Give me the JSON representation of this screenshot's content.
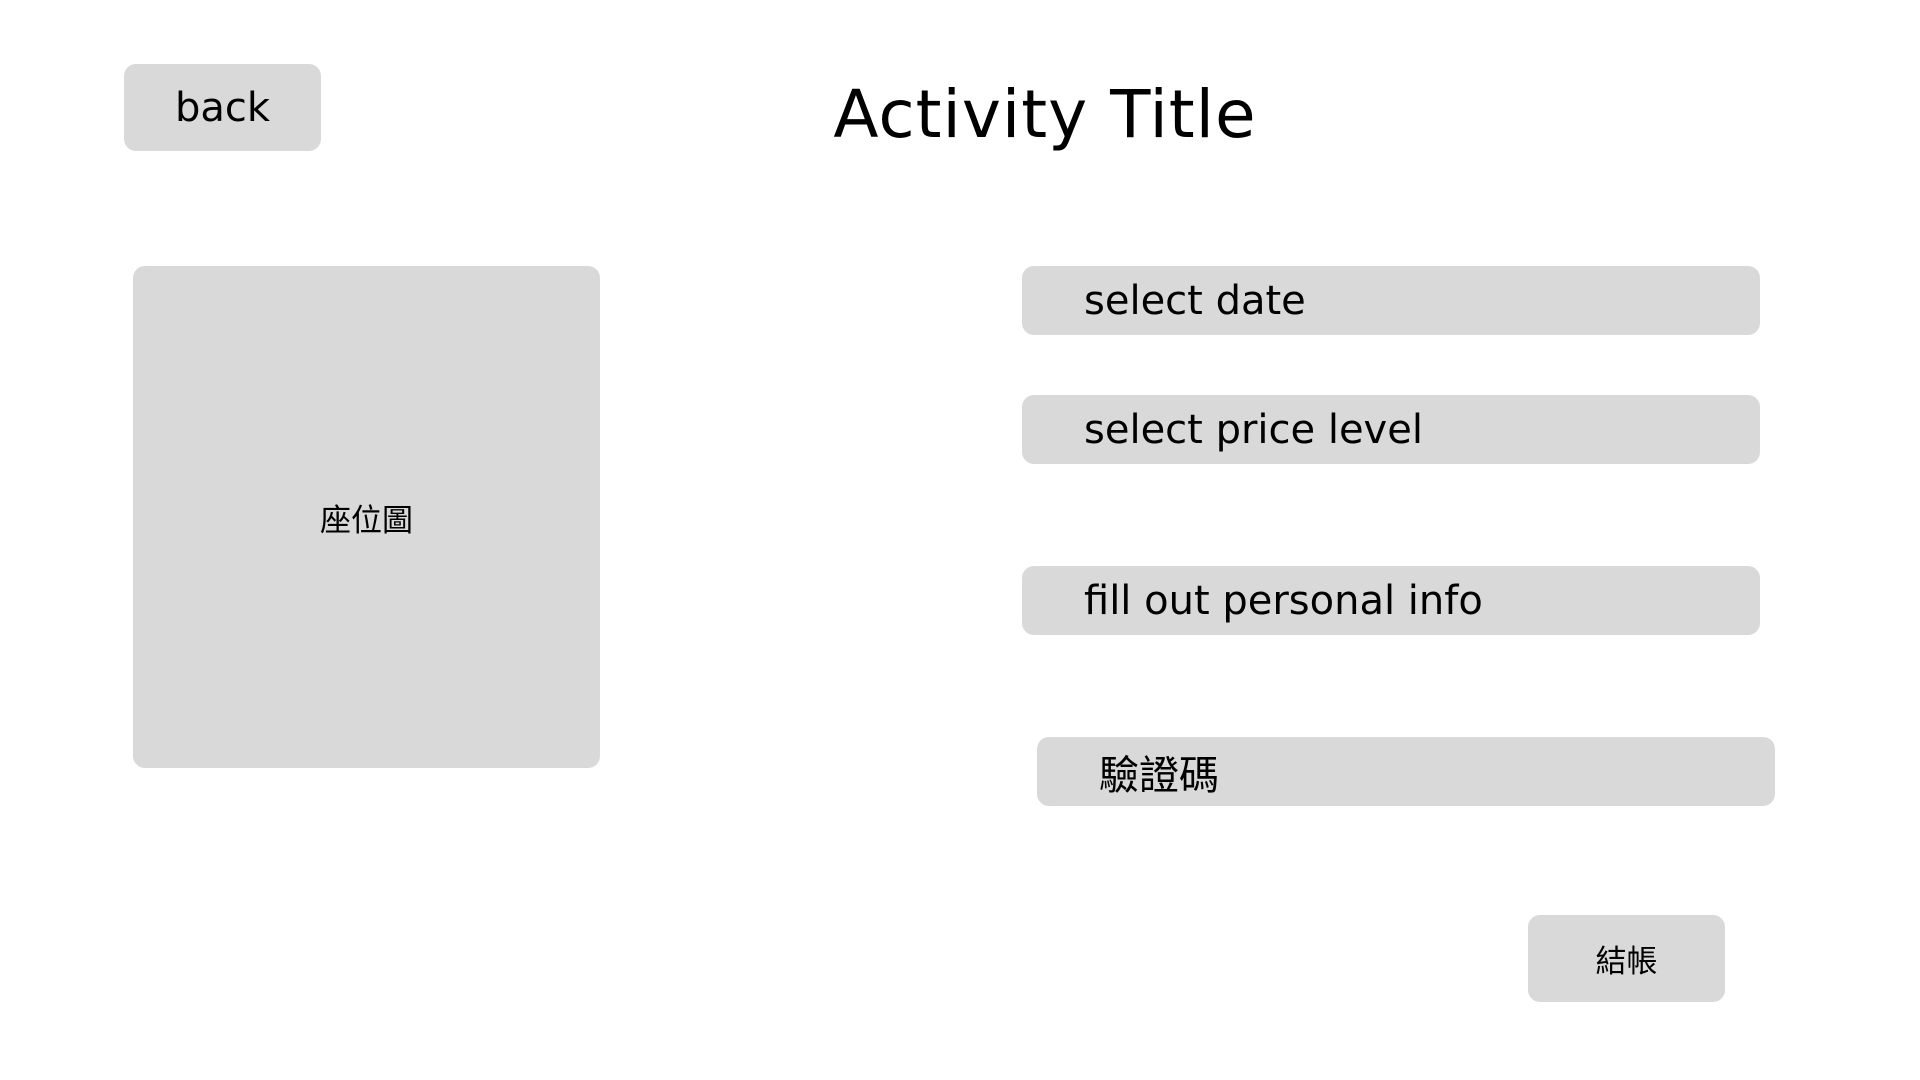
{
  "header": {
    "back_label": "back",
    "title": "Activity Title"
  },
  "seat_map": {
    "label": "座位圖"
  },
  "form": {
    "select_date": "select date",
    "select_price_level": "select price level",
    "personal_info": "fill out personal info",
    "captcha": "驗證碼"
  },
  "actions": {
    "checkout_label": "結帳"
  },
  "colors": {
    "box_background": "#d9d9d9",
    "page_background": "#ffffff",
    "text": "#000000"
  }
}
